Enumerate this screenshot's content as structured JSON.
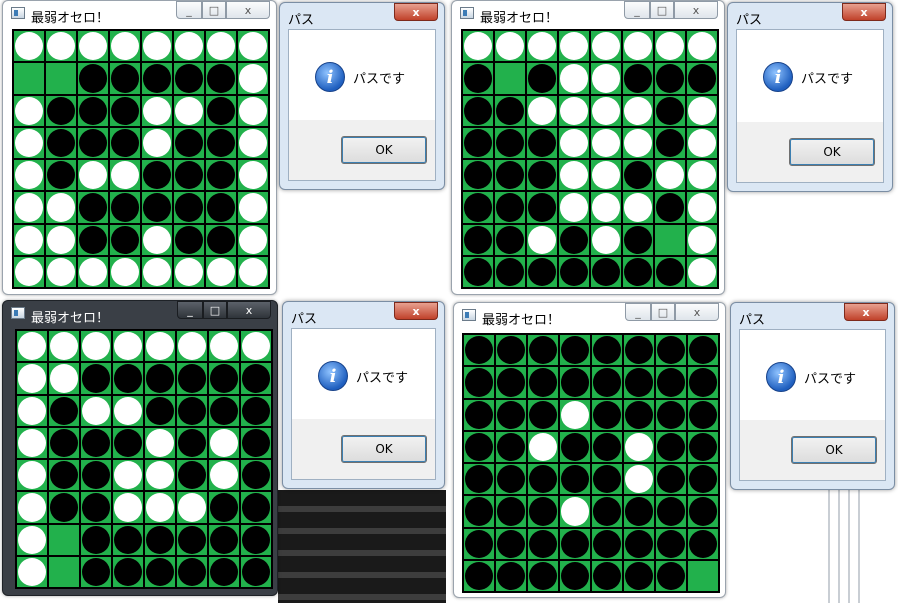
{
  "app_title": "最弱オセロ！",
  "pass_dialog": {
    "title": "パス",
    "message": "パスです",
    "ok_label": "OK",
    "close_label": "x",
    "icon": "info-icon"
  },
  "window_controls": {
    "min": "_",
    "max": "□",
    "close": "x"
  },
  "colors": {
    "board_green": "#22b14c",
    "grid": "#000000",
    "white_disc": "#ffffff",
    "black_disc": "#000000"
  },
  "boards": [
    [
      "WWWWWWWW",
      "EEBBBBBW",
      "WBBBWWBW",
      "WBBBWBBW",
      "WBWWBBBW",
      "WWBBBBBW",
      "WWBBWBBW",
      "WWWWWWWW"
    ],
    [
      "WWWWWWWW",
      "BEBWWBBB",
      "BBWWWWBW",
      "BBBWWWBW",
      "BBBWWBWW",
      "BBBWWWBW",
      "BBWBWBEW",
      "BBBBBBBW"
    ],
    [
      "WWWWWWWW",
      "WWBBBBBB",
      "WBWWBBBB",
      "WBBBWBWB",
      "WBBWWBWB",
      "WBBWWWBB",
      "WEBBBBBB",
      "WEBBBBBB"
    ],
    [
      "BBBBBBBB",
      "BBBBBBBB",
      "BBBWBBBB",
      "BBWBBWBB",
      "BBBBBWBB",
      "BBBWBBBB",
      "BBBBBBBB",
      "BBBBBBBE"
    ]
  ]
}
